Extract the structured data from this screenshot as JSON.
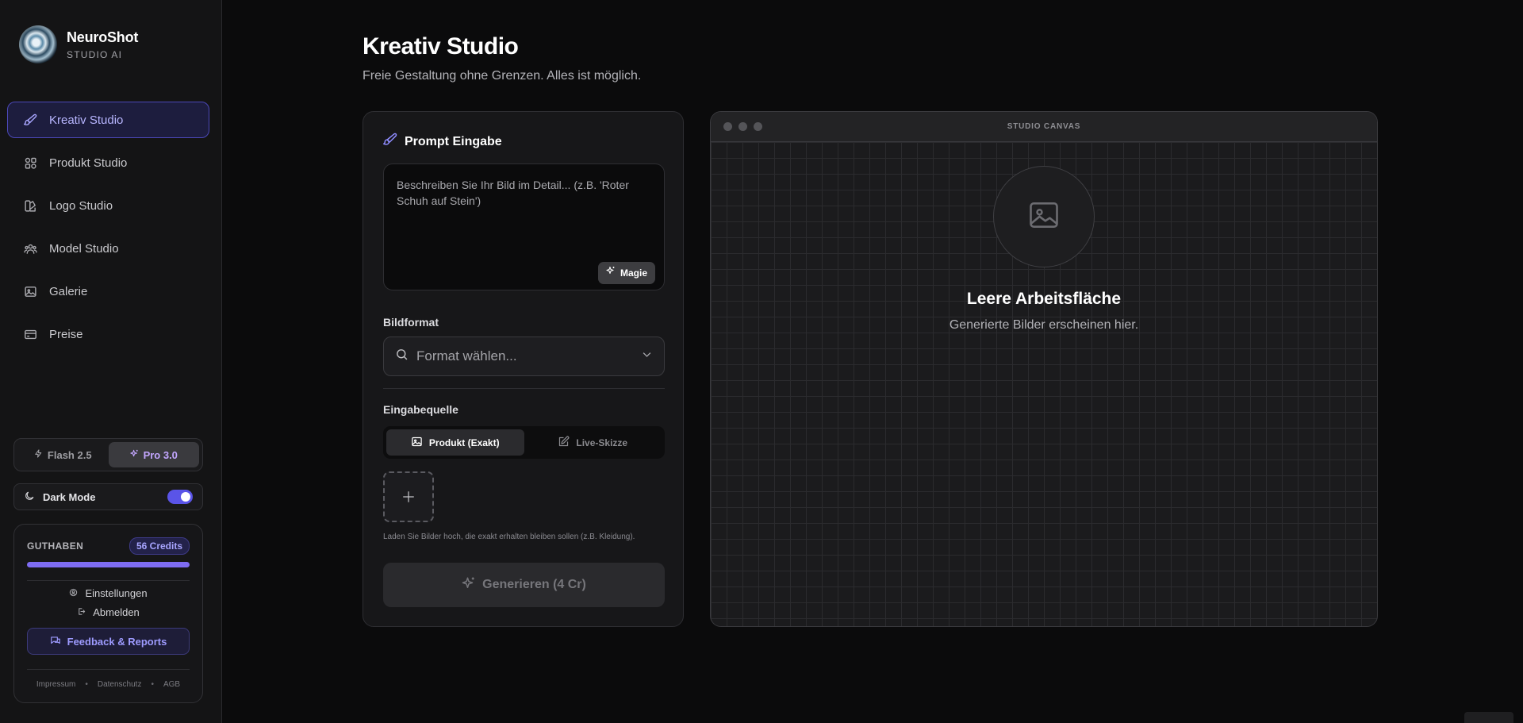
{
  "brand": {
    "title": "NeuroShot",
    "subtitle": "STUDIO AI"
  },
  "sidebar": {
    "items": [
      {
        "label": "Kreativ Studio",
        "icon": "brush-icon",
        "active": true
      },
      {
        "label": "Produkt Studio",
        "icon": "grid-icon"
      },
      {
        "label": "Logo Studio",
        "icon": "palette-icon"
      },
      {
        "label": "Model Studio",
        "icon": "users-icon"
      },
      {
        "label": "Galerie",
        "icon": "image-icon"
      },
      {
        "label": "Preise",
        "icon": "credit-card-icon"
      }
    ],
    "model_toggle": {
      "flash": "Flash 2.5",
      "pro": "Pro 3.0",
      "selected": "Pro 3.0"
    },
    "dark_mode": {
      "label": "Dark Mode",
      "enabled": true
    },
    "credits": {
      "title": "GUTHABEN",
      "badge": "56 Credits",
      "fill_fraction": 1.0,
      "settings": "Einstellungen",
      "logout": "Abmelden",
      "feedback": "Feedback & Reports",
      "legal": [
        "Impressum",
        "Datenschutz",
        "AGB"
      ]
    }
  },
  "main": {
    "title": "Kreativ Studio",
    "subtitle": "Freie Gestaltung ohne Grenzen. Alles ist möglich.",
    "prompt": {
      "heading": "Prompt Eingabe",
      "placeholder": "Beschreiben Sie Ihr Bild im Detail... (z.B. 'Roter Schuh auf Stein')",
      "magic_label": "Magie"
    },
    "format": {
      "label": "Bildformat",
      "placeholder": "Format wählen..."
    },
    "source": {
      "label": "Eingabequelle",
      "options": [
        "Produkt (Exakt)",
        "Live-Skizze"
      ],
      "selected": "Produkt (Exakt)",
      "hint": "Laden Sie Bilder hoch, die exakt erhalten bleiben sollen (z.B. Kleidung)."
    },
    "generate_label": "Generieren (4 Cr)"
  },
  "canvas": {
    "title": "STUDIO CANVAS",
    "empty_title": "Leere Arbeitsfläche",
    "empty_sub": "Generierte Bilder erscheinen hier."
  },
  "colors": {
    "accent": "#5a54e8",
    "active_text": "#b8b6ff",
    "background": "#0b0b0c"
  }
}
